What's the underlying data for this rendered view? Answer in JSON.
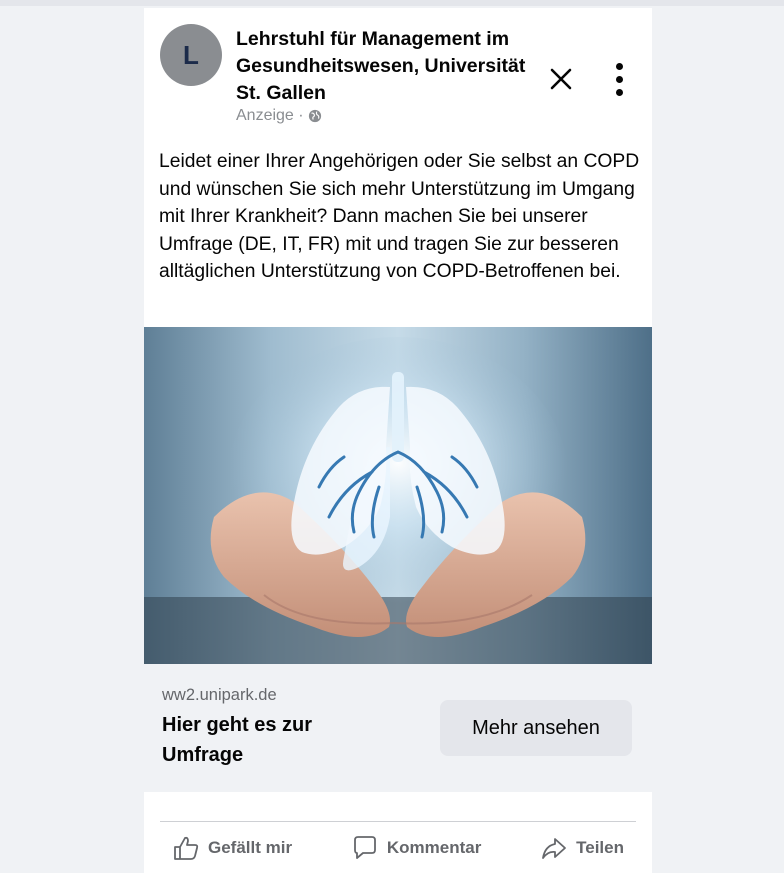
{
  "post": {
    "avatar_letter": "L",
    "page_name": "Lehrstuhl für Management im Gesundheitswesen, Universität St. Gallen",
    "sponsored_label": "Anzeige ·",
    "icons": {
      "privacy": "globe-icon",
      "close": "close-icon",
      "more": "more-options-icon"
    },
    "body_text": "Leidet einer Ihrer Angehörigen oder Sie selbst an COPD und wünschen Sie sich mehr Unterstützung im Umgang mit Ihrer Krankheit? Dann machen Sie bei unserer Umfrage (DE, IT, FR) mit und tragen Sie zur besseren alltäglichen Unterstützung von COPD-Betroffenen bei."
  },
  "link_preview": {
    "domain": "ww2.unipark.de",
    "headline": "Hier geht es zur Umfrage",
    "cta_label": "Mehr ansehen"
  },
  "actions": {
    "like_label": "Gefällt mir",
    "comment_label": "Kommentar",
    "share_label": "Teilen"
  },
  "colors": {
    "background": "#f0f2f5",
    "card": "#ffffff",
    "text": "#050505",
    "secondary_text": "#65676b",
    "button": "#e4e6eb"
  }
}
